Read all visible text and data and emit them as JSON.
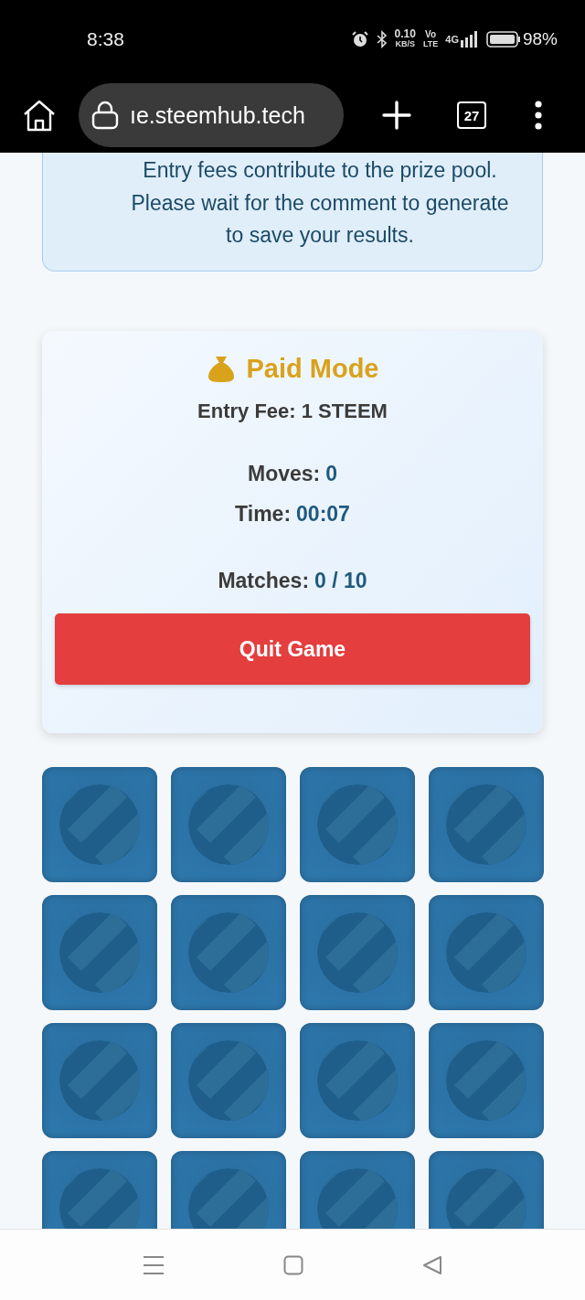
{
  "status_bar": {
    "time": "8:38",
    "net_speed": "0.10",
    "net_unit": "KB/S",
    "volte": "Vo",
    "volte_sub": "LTE",
    "network": "4G",
    "battery": "98%"
  },
  "browser": {
    "url": "ıe.steemhub.tech",
    "tab_count": "27"
  },
  "notice": {
    "text": "Entry fees contribute to the prize pool. Please wait for the comment to generate to save your results."
  },
  "game": {
    "mode": "Paid Mode",
    "entry_fee": "Entry Fee: 1 STEEM",
    "stats": [
      {
        "label": "Moves:",
        "value": "0"
      },
      {
        "label": "Time:",
        "value": "00:07"
      },
      {
        "label": "Matches:",
        "value": "0 / 10"
      }
    ],
    "quit_button": "Quit Game"
  },
  "cards": [
    {
      "kind": "hidden"
    },
    {
      "kind": "hidden"
    },
    {
      "kind": "hidden"
    },
    {
      "kind": "hidden"
    },
    {
      "kind": "hidden"
    },
    {
      "kind": "hidden"
    },
    {
      "kind": "hidden"
    },
    {
      "kind": "hidden"
    },
    {
      "kind": "hidden"
    },
    {
      "kind": "hidden"
    },
    {
      "kind": "hidden"
    },
    {
      "kind": "hidden"
    },
    {
      "kind": "hidden"
    },
    {
      "kind": "hidden"
    },
    {
      "kind": "hidden"
    },
    {
      "kind": "hidden"
    }
  ]
}
